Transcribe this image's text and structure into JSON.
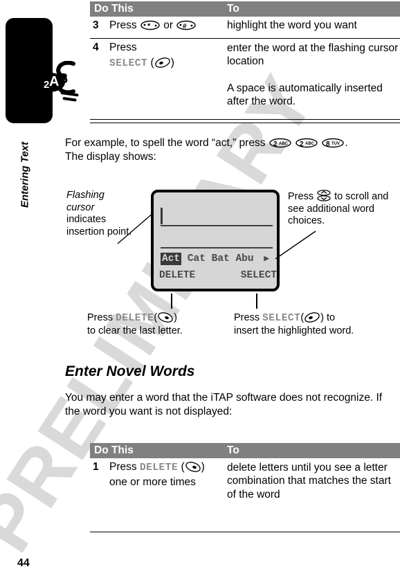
{
  "page": {
    "number": "44",
    "side_tab": "Entering Text",
    "watermark": "PRELIMINARY"
  },
  "phone_illustration": {
    "key_badge_digit": "2",
    "key_badge_letters": "ABC"
  },
  "table_top": {
    "headers": {
      "do_this": "Do This",
      "to": "To"
    },
    "rows": [
      {
        "num": "3",
        "do_this_pre": "Press",
        "key_1": "*",
        "do_this_mid": "or",
        "key_2": "#",
        "to": "highlight the word you want"
      },
      {
        "num": "4",
        "do_this_pre": "Press",
        "softkey_label": "SELECT",
        "to": "enter the word at the flashing cursor location",
        "to_note": "A space is automatically inserted after the word."
      }
    ]
  },
  "example_paragraph": {
    "line_1_pre": "For example, to spell the word “act,” press",
    "keys": [
      {
        "digit": "2",
        "letters": "ABC"
      },
      {
        "digit": "2",
        "letters": "ABC"
      },
      {
        "digit": "8",
        "letters": "TUV"
      }
    ],
    "line_1_post": ".",
    "line_2": "The display shows:"
  },
  "diagram": {
    "left_callout": {
      "italic_line_1": "Flashing",
      "italic_line_2": "cursor",
      "rest": "indicates insertion point."
    },
    "right_callout": {
      "pre": "Press",
      "icon": "nav-up-down-key-icon",
      "post": "to scroll and see additional word choices."
    },
    "screen": {
      "word_choices": [
        "Act",
        "Cat",
        "Bat",
        "Abu"
      ],
      "selected_word": "Act",
      "more_arrow": "▶",
      "softkey_left": "DELETE",
      "softkey_right": "SELECT"
    },
    "bottom_left_caption": {
      "pre": "Press",
      "key": "DELETE",
      "mid": "(",
      "icon": "left-softkey-icon",
      "post": ")",
      "line_2": "to clear the last letter."
    },
    "bottom_right_caption": {
      "pre": "Press",
      "key": "SELECT",
      "mid": "(",
      "icon": "right-softkey-icon",
      "post": ") to",
      "line_2": "insert the highlighted word."
    }
  },
  "section": {
    "heading": "Enter Novel Words",
    "paragraph": "You may enter a word that the iTAP software does not recognize. If the word you want is not displayed:"
  },
  "table_bottom": {
    "headers": {
      "do_this": "Do This",
      "to": "To"
    },
    "rows": [
      {
        "num": "1",
        "do_this_pre": "Press",
        "softkey_label": "DELETE",
        "do_this_line2": "one or more times",
        "to": "delete letters until you see a letter combination that matches the start of the word"
      }
    ]
  },
  "colors": {
    "header_bar": "#808080",
    "screen_bg": "#d6d6d6",
    "softkey_text": "#8a8a8a",
    "watermark": "#d9d9d9"
  }
}
